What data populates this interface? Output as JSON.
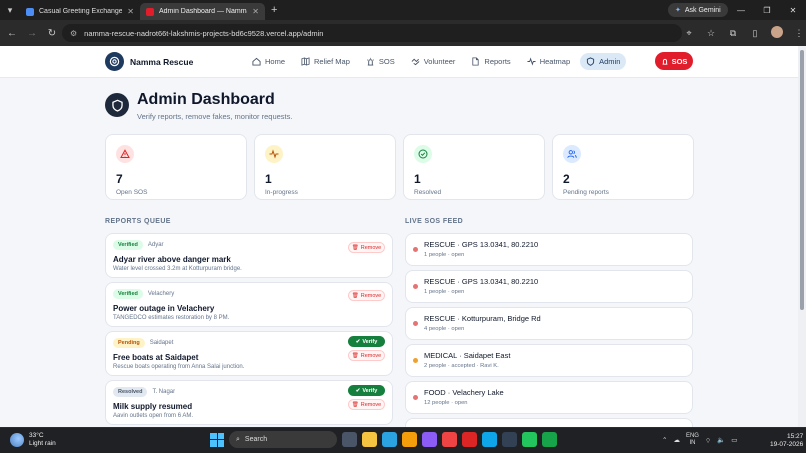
{
  "browser": {
    "tabs": [
      {
        "title": "Casual Greeting Exchange - Gemini",
        "favicon_color": "#4c8df6",
        "active": false
      },
      {
        "title": "Admin Dashboard — Namma Rescue",
        "favicon_color": "#e11d2b",
        "active": true
      }
    ],
    "new_tab": "+",
    "ask_gemini": "Ask Gemini",
    "url": "namma-rescue-nadrot66t-lakshmis-projects-bd6c9528.vercel.app/admin"
  },
  "app": {
    "brand": "Namma Rescue",
    "nav": [
      {
        "label": "Home",
        "icon": "home-icon",
        "active": false
      },
      {
        "label": "Relief Map",
        "icon": "map-icon",
        "active": false
      },
      {
        "label": "SOS",
        "icon": "sos-icon",
        "active": false
      },
      {
        "label": "Volunteer",
        "icon": "handshake-icon",
        "active": false
      },
      {
        "label": "Reports",
        "icon": "document-icon",
        "active": false
      },
      {
        "label": "Heatmap",
        "icon": "activity-icon",
        "active": false
      },
      {
        "label": "Admin",
        "icon": "shield-icon",
        "active": true
      }
    ],
    "sos_button": "SOS"
  },
  "header": {
    "title": "Admin Dashboard",
    "subtitle": "Verify reports, remove fakes, monitor requests."
  },
  "stats": [
    {
      "value": "7",
      "label": "Open SOS",
      "icon": "alert-triangle-icon",
      "color": "#dc2626",
      "bg": "#fee2e2"
    },
    {
      "value": "1",
      "label": "In-progress",
      "icon": "activity-icon",
      "color": "#b45309",
      "bg": "#fef3c7"
    },
    {
      "value": "1",
      "label": "Resolved",
      "icon": "check-circle-icon",
      "color": "#15803d",
      "bg": "#dcfce7"
    },
    {
      "value": "2",
      "label": "Pending reports",
      "icon": "users-icon",
      "color": "#2563eb",
      "bg": "#dbeafe"
    }
  ],
  "reports_queue": {
    "title": "REPORTS QUEUE",
    "verify_label": "Verify",
    "remove_label": "Remove",
    "items": [
      {
        "status": "Verified",
        "location": "Adyar",
        "title": "Adyar river above danger mark",
        "desc": "Water level crossed 3.2m at Kotturpuram bridge."
      },
      {
        "status": "Verified",
        "location": "Velachery",
        "title": "Power outage in Velachery",
        "desc": "TANGEDCO estimates restoration by 8 PM."
      },
      {
        "status": "Pending",
        "location": "Saidapet",
        "title": "Free boats at Saidapet",
        "desc": "Rescue boats operating from Anna Salai junction."
      },
      {
        "status": "Resolved",
        "location": "T. Nagar",
        "title": "Milk supply resumed",
        "desc": "Aavin outlets open from 6 AM."
      }
    ]
  },
  "sos_feed": {
    "title": "LIVE SOS FEED",
    "items": [
      {
        "title": "RESCUE · GPS 13.0341, 80.2210",
        "sub": "1 people · open",
        "dot": "#e57373"
      },
      {
        "title": "RESCUE · GPS 13.0341, 80.2210",
        "sub": "1 people · open",
        "dot": "#e57373"
      },
      {
        "title": "RESCUE · Kotturpuram, Bridge Rd",
        "sub": "4 people · open",
        "dot": "#e57373"
      },
      {
        "title": "MEDICAL · Saidapet East",
        "sub": "2 people · accepted · Ravi K.",
        "dot": "#f0a030"
      },
      {
        "title": "FOOD · Velachery Lake",
        "sub": "12 people · open",
        "dot": "#e57373"
      }
    ]
  },
  "taskbar": {
    "weather_temp": "33°C",
    "weather_desc": "Light rain",
    "search": "Search",
    "lang_1": "ENG",
    "lang_2": "IN",
    "time": "15:27",
    "date": "19-07-2026"
  }
}
